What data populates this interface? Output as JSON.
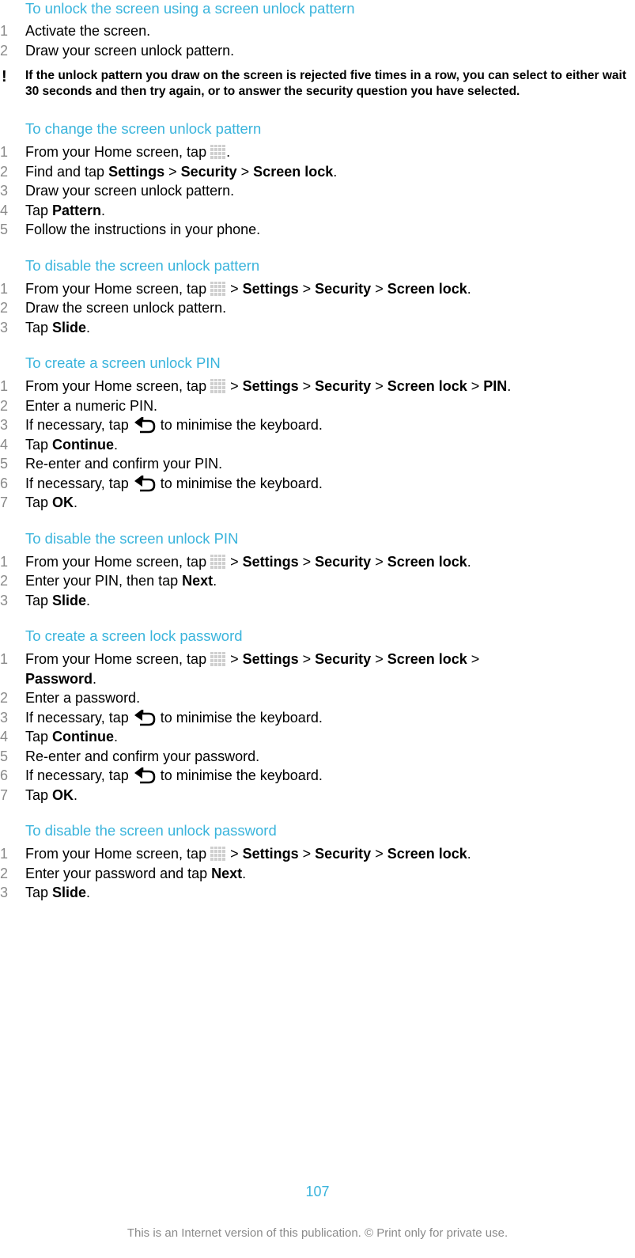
{
  "sections": [
    {
      "heading": "To unlock the screen using a screen unlock pattern",
      "steps": [
        {
          "num": "1",
          "text": "Activate the screen."
        },
        {
          "num": "2",
          "text": "Draw your screen unlock pattern."
        }
      ],
      "note": "If the unlock pattern you draw on the screen is rejected five times in a row, you can select to either wait 30 seconds and then try again, or to answer the security question you have selected."
    },
    {
      "heading": "To change the screen unlock pattern",
      "steps": [
        {
          "num": "1",
          "pre": "From your Home screen, tap ",
          "post": "."
        },
        {
          "num": "2",
          "pre": "Find and tap ",
          "b1": "Settings",
          "sep1": " > ",
          "b2": "Security",
          "sep2": " > ",
          "b3": "Screen lock",
          "end": "."
        },
        {
          "num": "3",
          "text": "Draw your screen unlock pattern."
        },
        {
          "num": "4",
          "pre": "Tap ",
          "b1": "Pattern",
          "end": "."
        },
        {
          "num": "5",
          "text": "Follow the instructions in your phone."
        }
      ]
    },
    {
      "heading": "To disable the screen unlock pattern",
      "steps": [
        {
          "num": "1",
          "pre": "From your Home screen, tap ",
          "sep0": " > ",
          "b1": "Settings",
          "sep1": " > ",
          "b2": "Security",
          "sep2": " > ",
          "b3": "Screen lock",
          "end": "."
        },
        {
          "num": "2",
          "text": "Draw the screen unlock pattern."
        },
        {
          "num": "3",
          "pre": "Tap ",
          "b1": "Slide",
          "end": "."
        }
      ]
    },
    {
      "heading": "To create a screen unlock PIN",
      "steps": [
        {
          "num": "1",
          "pre": "From your Home screen, tap ",
          "sep0": " > ",
          "b1": "Settings",
          "sep1": " > ",
          "b2": "Security",
          "sep2": " > ",
          "b3": "Screen lock",
          "sep3": " > ",
          "b4": "PIN",
          "end": "."
        },
        {
          "num": "2",
          "text": "Enter a numeric PIN."
        },
        {
          "num": "3",
          "pre": "If necessary, tap ",
          "post": " to minimise the keyboard."
        },
        {
          "num": "4",
          "pre": "Tap ",
          "b1": "Continue",
          "end": "."
        },
        {
          "num": "5",
          "text": "Re-enter and confirm your PIN."
        },
        {
          "num": "6",
          "pre": "If necessary, tap ",
          "post": " to minimise the keyboard."
        },
        {
          "num": "7",
          "pre": "Tap ",
          "b1": "OK",
          "end": "."
        }
      ]
    },
    {
      "heading": "To disable the screen unlock PIN",
      "steps": [
        {
          "num": "1",
          "pre": "From your Home screen, tap ",
          "sep0": " > ",
          "b1": "Settings",
          "sep1": " > ",
          "b2": "Security",
          "sep2": " > ",
          "b3": "Screen lock",
          "end": "."
        },
        {
          "num": "2",
          "pre": "Enter your PIN, then tap ",
          "b1": "Next",
          "end": "."
        },
        {
          "num": "3",
          "pre": "Tap ",
          "b1": "Slide",
          "end": "."
        }
      ]
    },
    {
      "heading": "To create a screen lock password",
      "steps": [
        {
          "num": "1",
          "pre": "From your Home screen, tap ",
          "sep0": " > ",
          "b1": "Settings",
          "sep1": " > ",
          "b2": "Security",
          "sep2": " > ",
          "b3": "Screen lock",
          "sep3": " >",
          "b4": "Password",
          "end": "."
        },
        {
          "num": "2",
          "text": "Enter a password."
        },
        {
          "num": "3",
          "pre": "If necessary, tap ",
          "post": " to minimise the keyboard."
        },
        {
          "num": "4",
          "pre": "Tap ",
          "b1": "Continue",
          "end": "."
        },
        {
          "num": "5",
          "text": "Re-enter and confirm your password."
        },
        {
          "num": "6",
          "pre": "If necessary, tap ",
          "post": " to minimise the keyboard."
        },
        {
          "num": "7",
          "pre": "Tap ",
          "b1": "OK",
          "end": "."
        }
      ]
    },
    {
      "heading": "To disable the screen unlock password",
      "steps": [
        {
          "num": "1",
          "pre": "From your Home screen, tap ",
          "sep0": " > ",
          "b1": "Settings",
          "sep1": " > ",
          "b2": "Security",
          "sep2": " > ",
          "b3": "Screen lock",
          "end": "."
        },
        {
          "num": "2",
          "pre": "Enter your password and tap ",
          "b1": "Next",
          "end": "."
        },
        {
          "num": "3",
          "pre": "Tap ",
          "b1": "Slide",
          "end": "."
        }
      ]
    }
  ],
  "page_number": "107",
  "footer": "This is an Internet version of this publication. © Print only for private use.",
  "colors": {
    "heading": "#3ab4dc",
    "step_number": "#8a8a8a"
  }
}
